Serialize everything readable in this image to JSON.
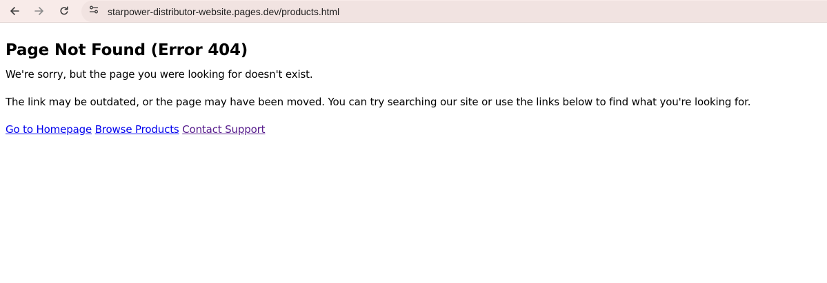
{
  "browser": {
    "url": "starpower-distributor-website.pages.dev/products.html",
    "back_icon": "arrow-left-icon",
    "forward_icon": "arrow-right-icon",
    "reload_icon": "reload-icon",
    "site_info_icon": "tune-icon"
  },
  "page": {
    "heading": "Page Not Found (Error 404)",
    "paragraph_1": "We're sorry, but the page you were looking for doesn't exist.",
    "paragraph_2": "The link may be outdated, or the page may have been moved. You can try searching our site or use the links below to find what you're looking for.",
    "links": {
      "homepage": "Go to Homepage",
      "products": "Browse Products",
      "support": "Contact Support"
    }
  },
  "colors": {
    "toolbar_bg": "#f8ebe9",
    "omnibox_bg": "#f1e3e1",
    "link": "#0000ee",
    "visited_link": "#551a8b"
  }
}
